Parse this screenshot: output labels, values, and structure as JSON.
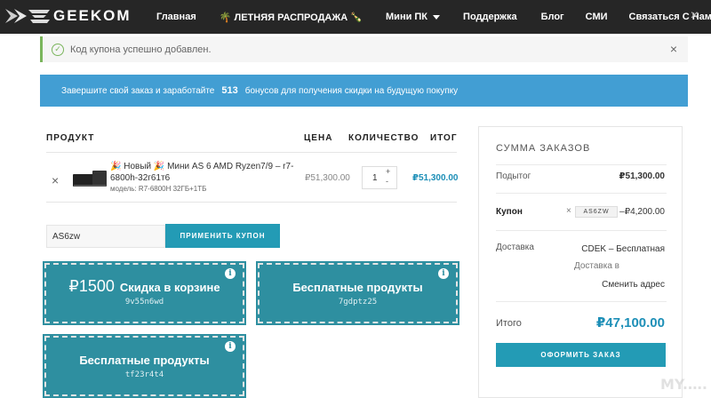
{
  "nav": {
    "brand": "GEEKOM",
    "items": [
      "Главная",
      "🌴 ЛЕТНЯЯ РАСПРОДАЖА 🍾",
      "Мини ПК",
      "Поддержка",
      "Блог",
      "СМИ",
      "Связаться С Нами"
    ],
    "close": "×"
  },
  "notice": {
    "text": "Код купона успешно добавлен.",
    "close": "×"
  },
  "banner": {
    "prefix": "Завершите свой заказ и заработайте",
    "points": "513",
    "suffix": "бонусов для получения скидки на будущую покупку"
  },
  "cart": {
    "headers": {
      "product": "ПРОДУКТ",
      "price": "ЦЕНА",
      "qty": "КОЛИЧЕСТВО",
      "total": "ИТОГ"
    },
    "item": {
      "remove": "×",
      "name": "🎉 Новый 🎉 Мини AS 6 AMD Ryzen7/9 – r7-6800h-32г61т6",
      "model_label": "модель:",
      "model": "R7-6800H 32ГБ+1ТБ",
      "price": "₽51,300.00",
      "qty": "1",
      "qty_up": "+",
      "qty_down": "-",
      "subtotal": "₽51,300.00"
    }
  },
  "coupon": {
    "value": "AS6zw",
    "button": "ПРИМЕНИТЬ КУПОН"
  },
  "promos": [
    {
      "amount": "₽1500",
      "title": "Скидка в корзине",
      "code": "9v55n6wd",
      "info": "i"
    },
    {
      "title": "Бесплатные продукты",
      "code": "7gdptz25",
      "info": "i"
    },
    {
      "title": "Бесплатные продукты",
      "code": "tf23r4t4",
      "info": "i"
    }
  ],
  "summary": {
    "title": "СУММА ЗАКАЗОВ",
    "subtotal_label": "Подытог",
    "subtotal": "₽51,300.00",
    "coupon_label": "Купон",
    "coupon_code": "AS6ZW",
    "coupon_remove": "×",
    "coupon_value": "–₽4,200.00",
    "shipping_label": "Доставка",
    "shipping_method": "CDEK – Бесплатная",
    "shipping_to": "Доставка в",
    "change_address": "Сменить адрес",
    "total_label": "Итого",
    "total": "₽47,100.00",
    "checkout": "ОФОРМИТЬ ЗАКАЗ"
  },
  "watermark": "MY.…."
}
